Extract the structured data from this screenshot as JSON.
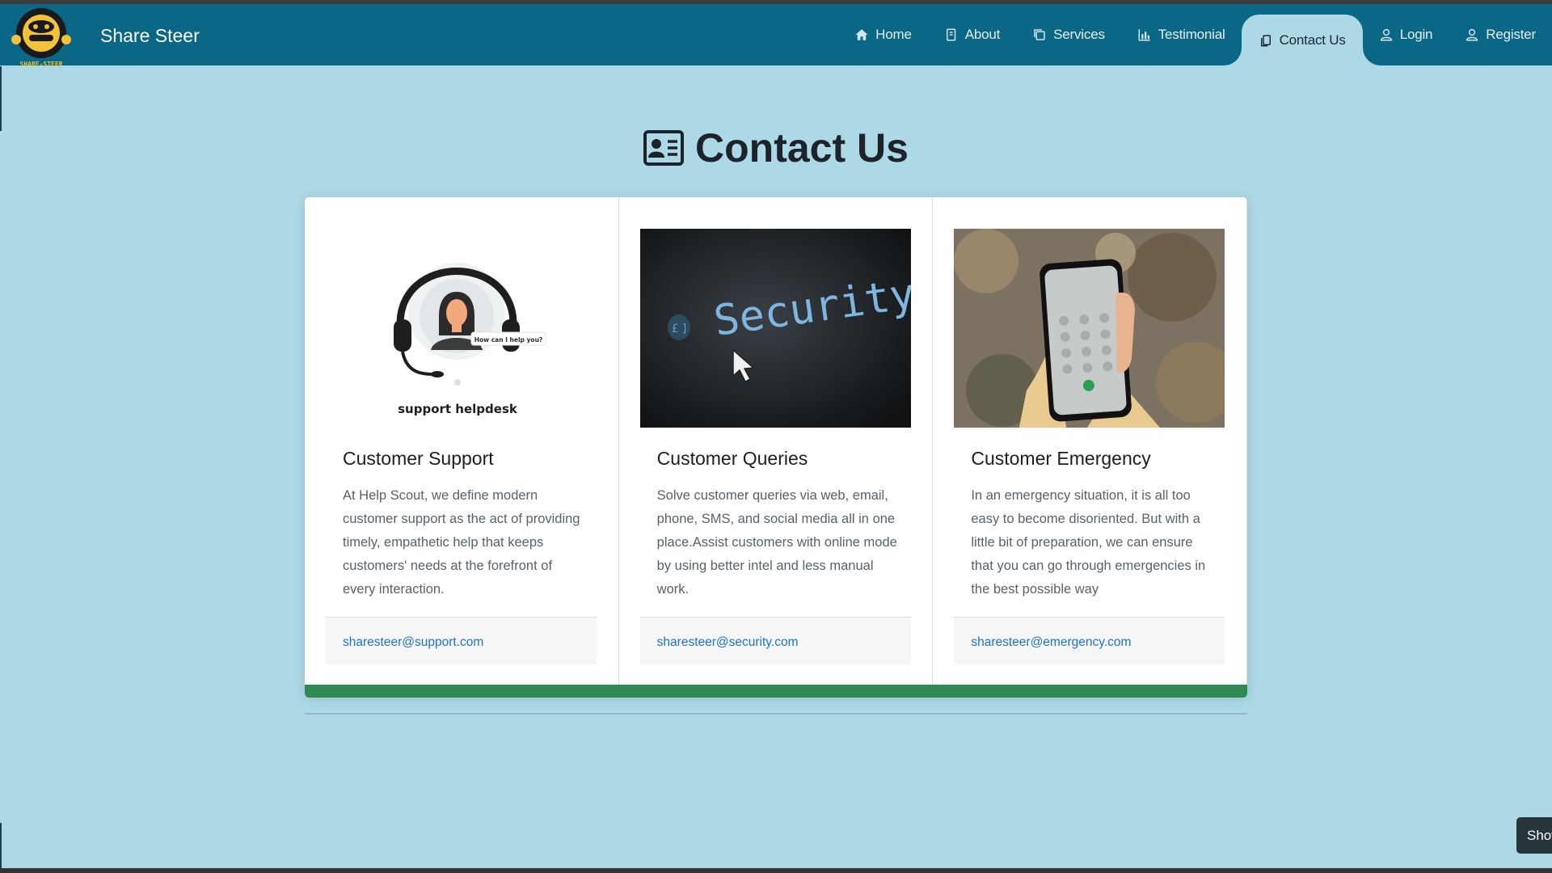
{
  "brand": {
    "name": "Share Steer",
    "logo_text": "SHARE-STEER"
  },
  "nav": {
    "items": [
      {
        "label": "Home",
        "icon": "home-icon"
      },
      {
        "label": "About",
        "icon": "book-icon"
      },
      {
        "label": "Services",
        "icon": "copy-icon"
      },
      {
        "label": "Testimonial",
        "icon": "chart-icon"
      },
      {
        "label": "Contact Us",
        "icon": "clipboard-icon",
        "active": true
      },
      {
        "label": "Login",
        "icon": "user-icon"
      },
      {
        "label": "Register",
        "icon": "user-icon"
      }
    ]
  },
  "page": {
    "title": "Contact Us",
    "title_icon": "address-card-icon"
  },
  "cards": [
    {
      "title": "Customer Support",
      "text": "At Help Scout, we define modern customer support as the act of providing timely, empathetic help that keeps customers' needs at the forefront of every interaction.",
      "email": "sharesteer@support.com",
      "image": "support-helpdesk-illustration",
      "image_caption": "support helpdesk",
      "image_bubble": "How can I help you?"
    },
    {
      "title": "Customer Queries",
      "text": "Solve customer queries via web, email, phone, SMS, and social media all in one place.Assist customers with online mode by using better intel and less manual work.",
      "email": "sharesteer@security.com",
      "image": "security-keyboard-photo",
      "image_text": "Security"
    },
    {
      "title": "Customer Emergency",
      "text": "In an emergency situation, it is all too easy to become disoriented. But with a little bit of preparation, we can ensure that you can go through emergencies in the best possible way",
      "email": "sharesteer@emergency.com",
      "image": "phone-dialpad-photo"
    }
  ],
  "floating_button": {
    "label": "Show"
  },
  "colors": {
    "navbar": "#0a6786",
    "background": "#add8e6",
    "accent_green": "#2f8a52",
    "link": "#1c72cf"
  }
}
